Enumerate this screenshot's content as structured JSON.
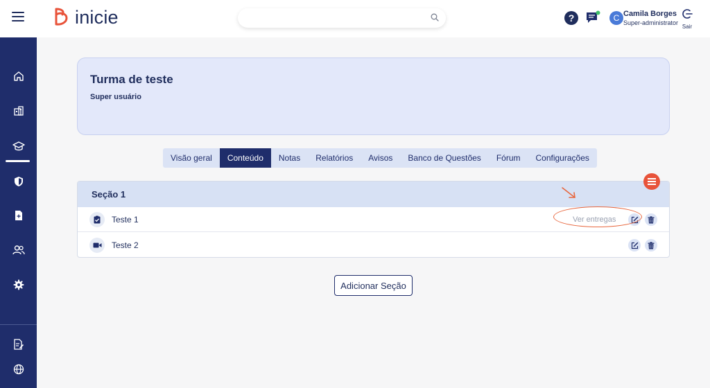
{
  "header": {
    "brand": "inicie",
    "search": {
      "placeholder": ""
    },
    "help_label": "?",
    "user": {
      "initial": "C",
      "name": "Camila Borges",
      "role": "Super-administrator"
    },
    "logout_label": "Sair"
  },
  "sidebar": {
    "items": [
      {
        "icon": "home-icon"
      },
      {
        "icon": "building-icon"
      },
      {
        "icon": "graduation-cap-icon",
        "active": true
      },
      {
        "icon": "shield-icon"
      },
      {
        "icon": "document-icon"
      },
      {
        "icon": "users-icon"
      },
      {
        "icon": "gear-icon"
      },
      {
        "icon": "report-icon"
      },
      {
        "icon": "globe-icon"
      }
    ]
  },
  "course": {
    "title": "Turma de teste",
    "subtitle": "Super usuário"
  },
  "tabs": [
    {
      "label": "Visão geral"
    },
    {
      "label": "Conteúdo",
      "active": true
    },
    {
      "label": "Notas"
    },
    {
      "label": "Relatórios"
    },
    {
      "label": "Avisos"
    },
    {
      "label": "Banco de Questões"
    },
    {
      "label": "Fórum"
    },
    {
      "label": "Configurações"
    }
  ],
  "section": {
    "title": "Seção 1",
    "rows": [
      {
        "label": "Teste 1",
        "icon": "task-check-icon",
        "action_label": "Ver entregas"
      },
      {
        "label": "Teste 2",
        "icon": "video-icon"
      }
    ]
  },
  "add_section_label": "Adicionar Seção",
  "colors": {
    "primary": "#1f2d6b",
    "accent": "#e8533a",
    "card_bg": "#e3e8fa",
    "tab_bg": "#dbe3f5"
  }
}
